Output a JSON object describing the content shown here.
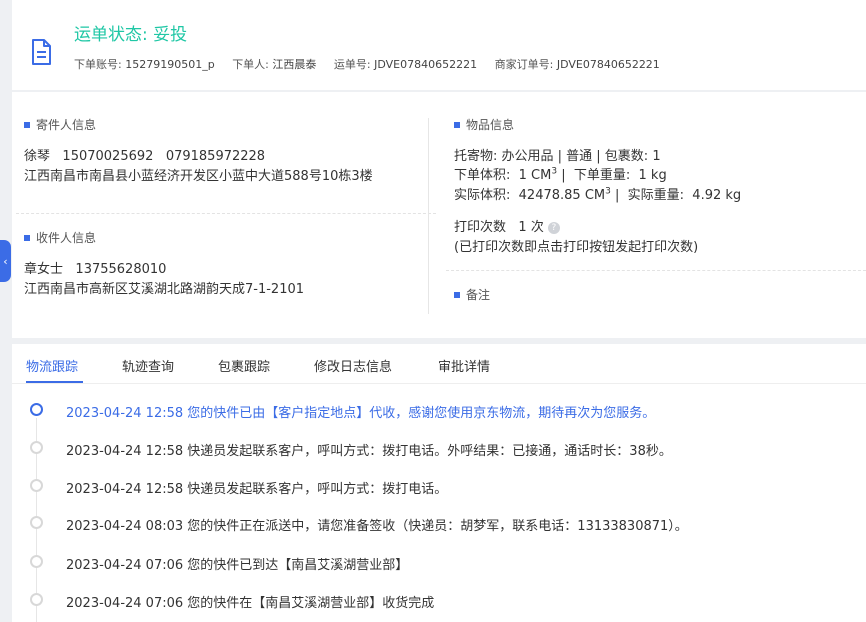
{
  "header": {
    "status_label": "运单状态: 妥投",
    "meta": [
      {
        "label": "下单账号:",
        "value": "15279190501_p"
      },
      {
        "label": "下单人:",
        "value": "江西晨泰"
      },
      {
        "label": "运单号:",
        "value": "JDVE07840652221"
      },
      {
        "label": "商家订单号:",
        "value": "JDVE07840652221"
      }
    ]
  },
  "sender": {
    "title": "寄件人信息",
    "name": "徐琴",
    "phone1": "15070025692",
    "phone2": "079185972228",
    "address": "江西南昌市南昌县小蓝经济开发区小蓝中大道588号10栋3楼"
  },
  "receiver": {
    "title": "收件人信息",
    "name": "章女士",
    "phone": "13755628010",
    "address": "江西南昌市高新区艾溪湖北路湖韵天成7-1-2101"
  },
  "goods": {
    "title": "物品信息",
    "line1": "托寄物:  办公用品 | 普通 | 包裹数:  1",
    "order_volume_label": "下单体积:",
    "order_volume_value": "1 CM",
    "order_weight_label": "下单重量:",
    "order_weight_value": "1 kg",
    "actual_volume_label": "实际体积:",
    "actual_volume_value": "42478.85 CM",
    "actual_weight_label": "实际重量:",
    "actual_weight_value": "4.92 kg",
    "volume_exponent": "3",
    "print_label": "打印次数",
    "print_value": "1 次",
    "print_help_icon": "?",
    "print_note": "(已打印次数即点击打印按钮发起打印次数)"
  },
  "remark": {
    "title": "备注"
  },
  "side_toggle": {
    "icon": "chevron-left-icon",
    "glyph": "‹"
  },
  "tabs": [
    {
      "label": "物流跟踪",
      "active": true
    },
    {
      "label": "轨迹查询"
    },
    {
      "label": "包裹跟踪"
    },
    {
      "label": "修改日志信息"
    },
    {
      "label": "审批详情"
    }
  ],
  "timeline": [
    {
      "time": "2023-04-24 12:58",
      "text": "您的快件已由【客户指定地点】代收，感谢您使用京东物流，期待再次为您服务。"
    },
    {
      "time": "2023-04-24 12:58",
      "text": "快递员发起联系客户，呼叫方式：拨打电话。外呼结果：已接通，通话时长：38秒。"
    },
    {
      "time": "2023-04-24 12:58",
      "text": "快递员发起联系客户，呼叫方式：拨打电话。"
    },
    {
      "time": "2023-04-24 08:03",
      "text": "您的快件正在派送中，请您准备签收（快递员：胡梦军，联系电话：13133830871）。"
    },
    {
      "time": "2023-04-24 07:06",
      "text": "您的快件已到达【南昌艾溪湖营业部】"
    },
    {
      "time": "2023-04-24 07:06",
      "text": "您的快件在【南昌艾溪湖营业部】收货完成"
    }
  ],
  "colors": {
    "accent": "#3b6ce6",
    "status": "#1fc7a5"
  }
}
